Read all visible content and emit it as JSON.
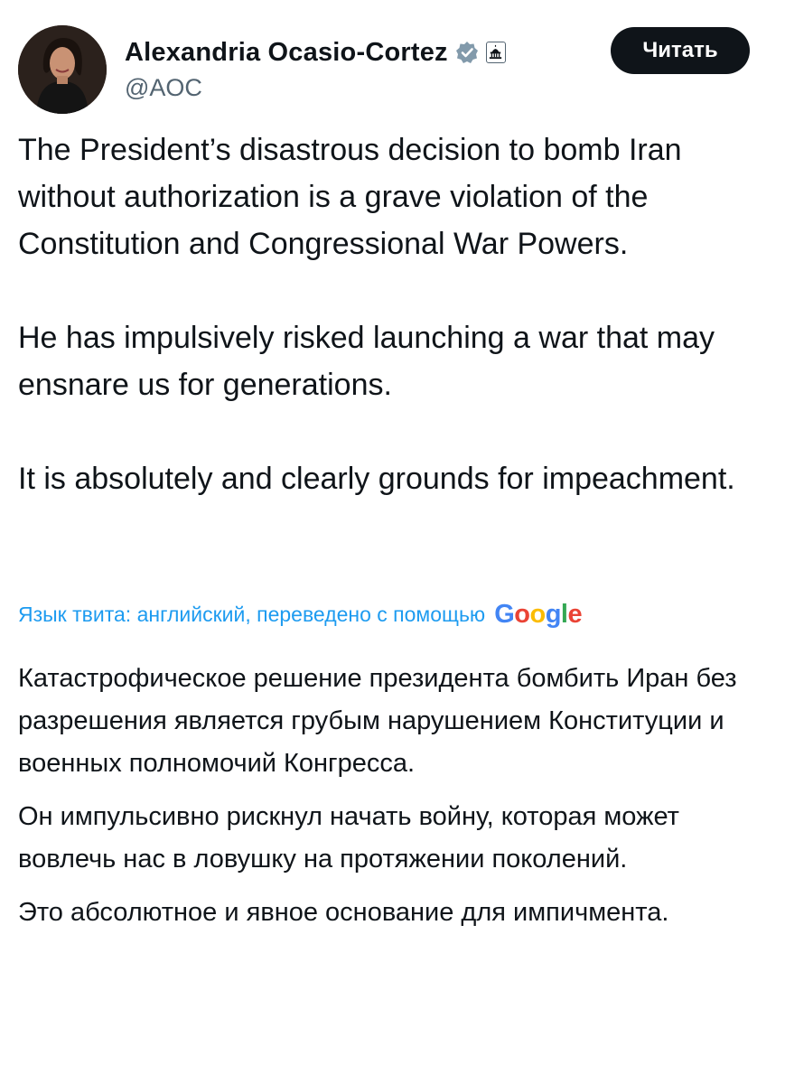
{
  "author": {
    "name": "Alexandria Ocasio-Cortez",
    "handle": "@AOC",
    "avatar_icon": "profile-photo",
    "verified_icon": "verified-badge-icon",
    "affiliation_icon": "us-capitol-icon"
  },
  "follow_button": {
    "label": "Читать"
  },
  "tweet": {
    "paragraphs": [
      "The President’s disastrous decision to bomb Iran without authorization is a grave violation of the Constitution and Congressional War Powers.",
      "He has impulsively risked launching a war that may ensnare us for generations.",
      "It is absolutely and clearly grounds for impeachment."
    ]
  },
  "translation_info": {
    "label": "Язык твита: английский, переведено с помощью",
    "provider": "Google"
  },
  "translation": {
    "paragraphs": [
      "Катастрофическое решение президента бомбить Иран без разрешения является грубым нарушением Конституции и военных полномочий Конгресса.",
      "Он импульсивно рискнул начать войну, которая может вовлечь нас в ловушку на протяжении поколений.",
      "Это абсолютное и явное основание для импичмента."
    ]
  },
  "colors": {
    "text_primary": "#0f1419",
    "text_secondary": "#536471",
    "link_blue": "#1d9bf0",
    "button_bg": "#0f1419"
  }
}
